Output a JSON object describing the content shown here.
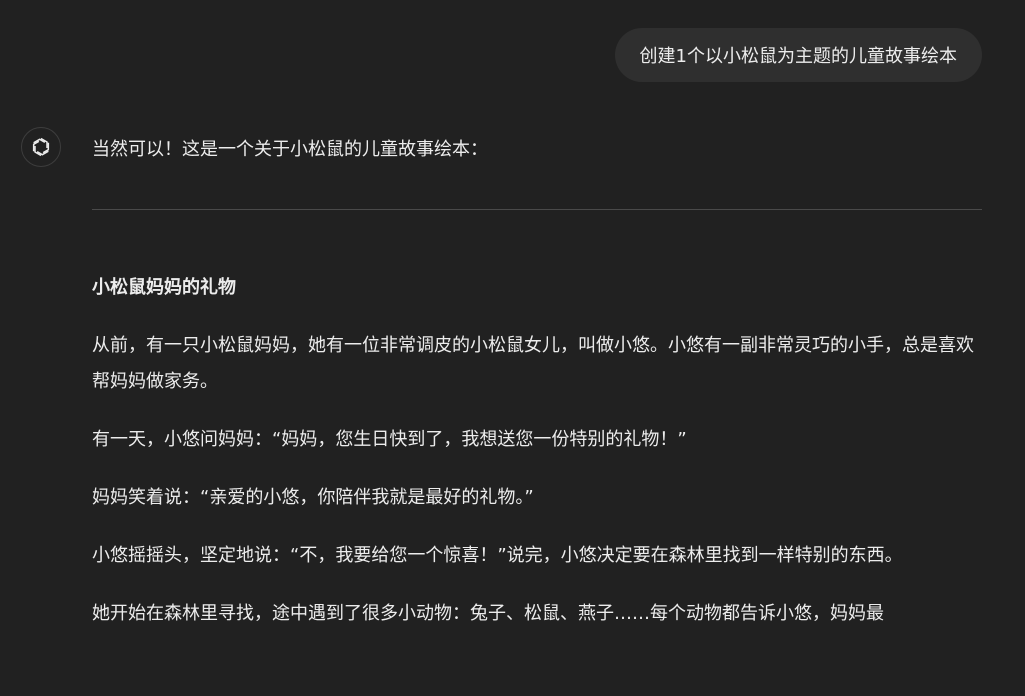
{
  "user_message": {
    "text": "创建1个以小松鼠为主题的儿童故事绘本"
  },
  "assistant": {
    "avatar_icon": "openai-logo-icon",
    "intro": "当然可以！这是一个关于小松鼠的儿童故事绘本：",
    "story_title": "小松鼠妈妈的礼物",
    "paragraphs": [
      "从前，有一只小松鼠妈妈，她有一位非常调皮的小松鼠女儿，叫做小悠。小悠有一副非常灵巧的小手，总是喜欢帮妈妈做家务。",
      "有一天，小悠问妈妈：“妈妈，您生日快到了，我想送您一份特别的礼物！”",
      "妈妈笑着说：“亲爱的小悠，你陪伴我就是最好的礼物。”",
      "小悠摇摇头，坚定地说：“不，我要给您一个惊喜！”说完，小悠决定要在森林里找到一样特别的东西。",
      "她开始在森林里寻找，途中遇到了很多小动物：兔子、松鼠、燕子……每个动物都告诉小悠，妈妈最"
    ]
  },
  "colors": {
    "background": "#212121",
    "user_bubble": "#2f2f2f",
    "text": "#ececec",
    "divider": "#4a4a4a"
  }
}
